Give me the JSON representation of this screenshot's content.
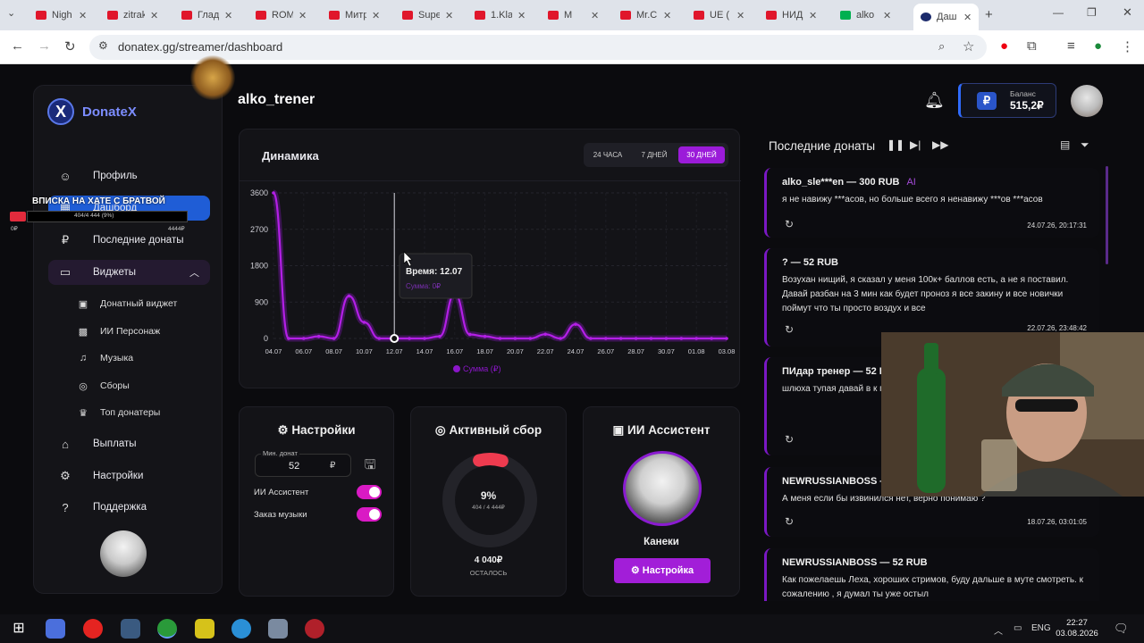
{
  "browser": {
    "tabs": [
      {
        "label": "Nigh",
        "icon": "youtube-icon"
      },
      {
        "label": "zitrak",
        "icon": "youtube-icon"
      },
      {
        "label": "Глад",
        "icon": "youtube-icon"
      },
      {
        "label": "ROM",
        "icon": "youtube-icon"
      },
      {
        "label": "Митр",
        "icon": "youtube-icon"
      },
      {
        "label": "Supe",
        "icon": "youtube-icon"
      },
      {
        "label": "1.Kla",
        "icon": "youtube-icon"
      },
      {
        "label": "M",
        "icon": "youtube-icon"
      },
      {
        "label": "Mr.C",
        "icon": "youtube-icon"
      },
      {
        "label": "UE (",
        "icon": "youtube-icon"
      },
      {
        "label": "НИД",
        "icon": "youtube-icon"
      },
      {
        "label": "alko",
        "icon": "kick-icon"
      },
      {
        "label": "Даш",
        "icon": "donatex-icon"
      }
    ],
    "url": "donatex.gg/streamer/dashboard"
  },
  "sidebar": {
    "logo": "DonateX",
    "nav": [
      {
        "label": "Профиль",
        "icon": "user-icon"
      },
      {
        "label": "Дашборд",
        "icon": "dashboard-icon"
      },
      {
        "label": "Последние донаты",
        "icon": "ruble-icon"
      },
      {
        "label": "Виджеты",
        "icon": "widgets-icon"
      }
    ],
    "widgets": [
      {
        "label": "Донатный виджет"
      },
      {
        "label": "ИИ Персонаж"
      },
      {
        "label": "Музыка"
      },
      {
        "label": "Сборы"
      },
      {
        "label": "Топ донатеры"
      }
    ],
    "bottom": [
      {
        "label": "Выплаты",
        "icon": "bank-icon"
      },
      {
        "label": "Настройки",
        "icon": "gear-icon"
      },
      {
        "label": "Поддержка",
        "icon": "help-icon"
      }
    ]
  },
  "header": {
    "username": "alko_trener",
    "balance_label": "Баланс",
    "balance_value": "515,2₽",
    "currency_symbol": "₽"
  },
  "chart": {
    "title": "Динамика",
    "periods": [
      "24 ЧАСА",
      "7 ДНЕЙ",
      "30 ДНЕЙ"
    ],
    "active_period": "30 ДНЕЙ",
    "tooltip": "Время: 12.07",
    "tooltip_sub": "Сумма: 0₽",
    "legend": "Сумма (₽)"
  },
  "chart_data": {
    "type": "line",
    "x": [
      "04.07",
      "05.07",
      "06.07",
      "07.07",
      "08.07",
      "09.07",
      "10.07",
      "11.07",
      "12.07",
      "13.07",
      "14.07",
      "15.07",
      "16.07",
      "17.07",
      "18.07",
      "19.07",
      "20.07",
      "21.07",
      "22.07",
      "23.07",
      "24.07",
      "25.07",
      "26.07",
      "27.07",
      "28.07",
      "29.07",
      "30.07",
      "31.07",
      "01.08",
      "02.08",
      "03.08"
    ],
    "xticks": [
      "04.07",
      "06.07",
      "08.07",
      "10.07",
      "12.07",
      "14.07",
      "16.07",
      "18.07",
      "20.07",
      "22.07",
      "24.07",
      "26.07",
      "28.07",
      "30.07",
      "01.08",
      "03.08"
    ],
    "series": [
      {
        "name": "Сумма (₽)",
        "values": [
          3600,
          0,
          0,
          52,
          0,
          1050,
          400,
          0,
          0,
          0,
          0,
          52,
          1100,
          100,
          52,
          0,
          0,
          0,
          104,
          0,
          350,
          0,
          0,
          0,
          0,
          0,
          0,
          0,
          0,
          0,
          0
        ]
      }
    ],
    "yticks": [
      0,
      900,
      1800,
      2700,
      3600
    ],
    "ylim": [
      0,
      3600
    ],
    "grid": true,
    "color": "#b31fe6"
  },
  "settings_card": {
    "title": "Настройки",
    "min_label": "Мин. донат",
    "min_value": "52",
    "currency": "₽",
    "toggle_ai": "ИИ Ассистент",
    "toggle_music": "Заказ музыки"
  },
  "goal_card": {
    "title": "Активный сбор",
    "percent": "9%",
    "progress_text": "404 / 4 444₽",
    "progress_fraction": 0.09,
    "remaining": "4 040₽",
    "remaining_label": "ОСТАЛОСЬ"
  },
  "ai_card": {
    "title": "ИИ Ассистент",
    "name": "Канеки",
    "button": "Настройка"
  },
  "donations": {
    "title": "Последние донаты",
    "items": [
      {
        "name": "alko_sle***en — 300 RUB",
        "tag": "AI",
        "message": "я не навижу ***асов, но больше всего я ненавижу ***ов ***асов",
        "time": "24.07.26, 20:17:31"
      },
      {
        "name": "? — 52 RUB",
        "tag": "",
        "message": "Возухан нищий, я сказал у меня 100к+ баллов есть, а не я поставил. Давай разбан на 3 мин как будет проноз я все закину и все новички поймут что ты просто воздух и все",
        "time": "22.07.26, 23:48:42"
      },
      {
        "name": "ПИдар тренер — 52 RUB",
        "tag": "",
        "message": "шлюха тупая давай в к посмотрим кто возду Щас все новички пойм",
        "time": ""
      },
      {
        "name": "NEWRUSSIANBOSS — 52 RUB",
        "tag": "",
        "message": "А меня если бы извинился нет, верно понимаю ?",
        "time": "18.07.26, 03:01:05"
      },
      {
        "name": "NEWRUSSIANBOSS — 52 RUB",
        "tag": "",
        "message": "Как пожелаешь Леха, хороших стримов, буду дальше в муте смотреть. к сожалению , я думал ты уже остыл",
        "time": ""
      }
    ]
  },
  "overlay": {
    "title": "ВПИСКА НА ХАТЕ С БРАТВОЙ",
    "bar_text": "404/4 444 (9%)",
    "goal_end": "4444₽",
    "goal_start": "0₽"
  },
  "taskbar": {
    "lang": "ENG",
    "time": "22:27",
    "date": "03.08.2026"
  }
}
